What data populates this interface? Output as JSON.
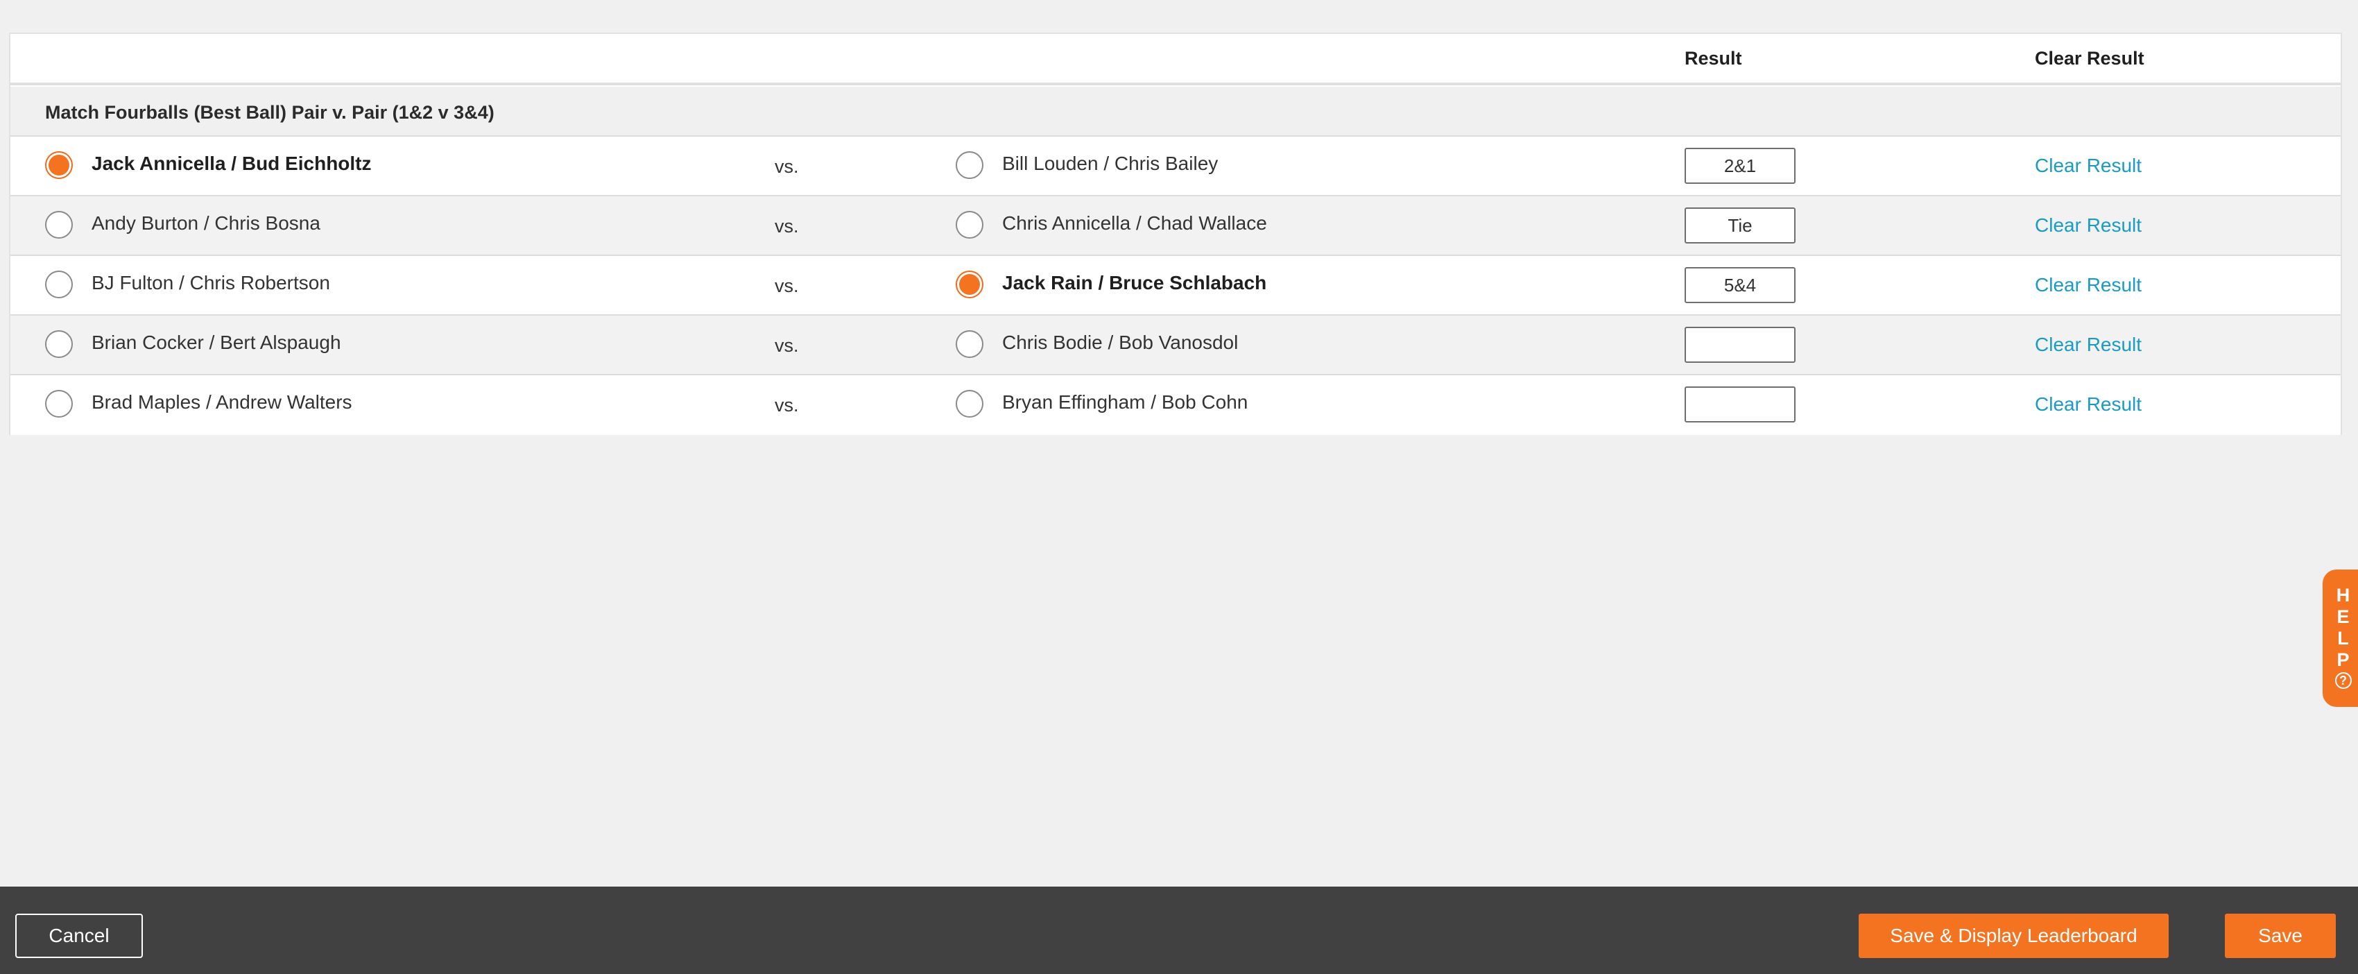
{
  "table": {
    "headers": {
      "result": "Result",
      "clear_result": "Clear Result"
    },
    "section_title": "Match Fourballs (Best Ball) Pair v. Pair (1&2 v 3&4)",
    "vs_label": "vs.",
    "clear_label": "Clear Result",
    "matches": [
      {
        "left": "Jack Annicella / Bud Eichholtz",
        "right": "Bill Louden / Chris Bailey",
        "winner": "left",
        "result": "2&1"
      },
      {
        "left": "Andy Burton / Chris Bosna",
        "right": "Chris Annicella / Chad Wallace",
        "winner": "none",
        "result": "Tie"
      },
      {
        "left": "BJ Fulton / Chris Robertson",
        "right": "Jack Rain / Bruce Schlabach",
        "winner": "right",
        "result": "5&4"
      },
      {
        "left": "Brian Cocker / Bert Alspaugh",
        "right": "Chris Bodie / Bob Vanosdol",
        "winner": "none",
        "result": ""
      },
      {
        "left": "Brad Maples / Andrew Walters",
        "right": "Bryan Effingham / Bob Cohn",
        "winner": "none",
        "result": ""
      }
    ]
  },
  "help": {
    "letters": [
      "H",
      "E",
      "L",
      "P"
    ],
    "icon": "question-circle-icon"
  },
  "footer": {
    "cancel_label": "Cancel",
    "save_display_label": "Save & Display Leaderboard",
    "save_label": "Save"
  },
  "colors": {
    "accent": "#f47321",
    "link": "#1a9bc6",
    "footer_bg": "#414141"
  }
}
